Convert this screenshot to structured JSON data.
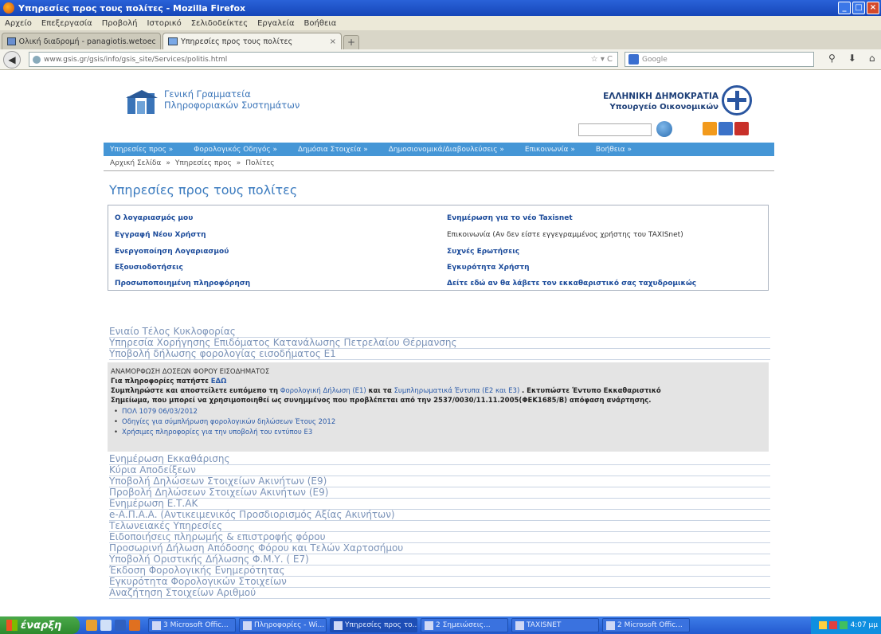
{
  "window": {
    "title": "Υπηρεσίες προς τους πολίτες - Mozilla Firefox",
    "controls": [
      "_",
      "□",
      "×"
    ]
  },
  "menubar": [
    "Αρχείο",
    "Επεξεργασία",
    "Προβολή",
    "Ιστορικό",
    "Σελιδοδείκτες",
    "Εργαλεία",
    "Βοήθεια"
  ],
  "tabs": [
    {
      "label": "Ολική διαδρομή - panagiotis.wetoecopa...",
      "close": "×"
    },
    {
      "label": "Υπηρεσίες προς τους πολίτες",
      "close": "×"
    }
  ],
  "new_tab": "+",
  "nav": {
    "back": "◀",
    "url": "www.gsis.gr/gsis/info/gsis_site/Services/politis.html",
    "url_end": "☆ ▾ C",
    "search_placeholder": "Google",
    "icons": [
      "⚲",
      "⬇",
      "⌂"
    ]
  },
  "site": {
    "org_line1": "Γενική Γραμματεία",
    "org_line2": "Πληροφοριακών Συστημάτων",
    "gov_line1": "ΕΛΛΗΝΙΚΗ ΔΗΜΟΚΡΑΤΙΑ",
    "gov_line2": "Υπουργείο Οικονομικών",
    "mainnav": [
      "Υπηρεσίες προς »",
      "Φορολογικός Οδηγός »",
      "Δημόσια Στοιχεία »",
      "Δημοσιονομικά/Διαβουλεύσεις »",
      "Επικοινωνία »",
      "Βοήθεια »"
    ],
    "breadcrumb": [
      "Αρχική Σελίδα",
      "»",
      "Υπηρεσίες προς",
      "»",
      "Πολίτες"
    ],
    "page_title": "Υπηρεσίες προς τους πολίτες",
    "services_left": [
      "Ο λογαριασμός μου",
      "Εγγραφή Νέου Χρήστη",
      "Ενεργοποίηση Λογαριασμού",
      "Εξουσιοδοτήσεις",
      "Προσωποποιημένη πληροφόρηση"
    ],
    "services_right": [
      "Ενημέρωση για το νέο Taxisnet",
      "Επικοινωνία (Αν δεν είστε εγγεγραμμένος χρήστης του TAXISnet)",
      "Συχνές Ερωτήσεις",
      "Εγκυρότητα Χρήστη",
      "Δείτε εδώ αν θα λάβετε τον εκκαθαριστικό σας ταχυδρομικώς"
    ],
    "links_top": [
      "Ενιαίο Τέλος Κυκλοφορίας",
      "Υπηρεσία Χορήγησης Επιδόματος Κατανάλωσης Πετρελαίου Θέρμανσης",
      "Υποβολή δήλωσης φορολογίας εισοδήματος Ε1"
    ],
    "e1": {
      "header": "ΑΝΑΜΟΡΦΩΣΗ ΔΟΣΕΩΝ ΦΟΡΟΥ ΕΙΣΟΔΗΜΑΤΟΣ",
      "info_label": "Για πληροφορίες πατήστε",
      "info_link": "ΕΔΩ",
      "para1_a": "Συμπληρώστε και αποστείλετε ευπόμεπο τη",
      "para1_link1": "Φορολογική Δήλωση (Ε1)",
      "para1_b": "και τα",
      "para1_link2": "Συμπληρωματικά Έντυπα (Ε2 και Ε3)",
      "para1_c": ". Εκτυπώστε Έντυπο Εκκαθαριστικό",
      "para2": "Σημείωμα, που μπορεί να χρησιμοποιηθεί ως συνημμένος που προβλέπεται από την 2537/0030/11.11.2005(ΦΕΚ1685/Β) απόφαση ανάρτησης.",
      "bullets": [
        "ΠΟΛ 1079 06/03/2012",
        "Οδηγίες για σύμπλήρωση φορολογικών δηλώσεων Έτους 2012",
        "Χρήσιμες πληροφορίες για την υποβολή του εντύπου Ε3"
      ]
    },
    "links_bottom": [
      "Ενημέρωση Εκκαθάρισης",
      "Κύρια Αποδείξεων",
      "Υποβολή Δηλώσεων Στοιχείων Ακινήτων (Ε9)",
      "Προβολή Δηλώσεων Στοιχείων Ακινήτων (Ε9)",
      "Ενημέρωση Ε.Τ.ΑΚ",
      "e-Α.Π.Α.Α. (Αντικειμενικός Προσδιορισμός Αξίας Ακινήτων)",
      "Τελωνειακές Υπηρεσίες",
      "Ειδοποιήσεις πληρωμής & επιστροφής φόρου",
      "Προσωρινή Δήλωση Απόδοσης Φόρου και Τελών Χαρτοσήμου",
      "Υποβολή Οριστικής Δήλωσης Φ.Μ.Υ. ( Ε7)",
      "Έκδοση Φορολογικής Ενημερότητας",
      "Εγκυρότητα Φορολογικών Στοιχείων",
      "Αναζήτηση Στοιχείων Αριθμού"
    ]
  },
  "taskbar": {
    "start": "έναρξη",
    "tasks": [
      "3 Microsoft Offic...",
      "Πληροφορίες - Wi...",
      "Υπηρεσίες προς το...",
      "2 Σημειώσεις...",
      "TAXISNET",
      "2 Microsoft Offic..."
    ],
    "clock": "4:07 μμ"
  },
  "colors": {
    "mainnav_bg": "#4596d6",
    "link_blue": "#1a4a9a",
    "title_blue": "#3b7bbf",
    "pale_link": "#7b93b8"
  }
}
